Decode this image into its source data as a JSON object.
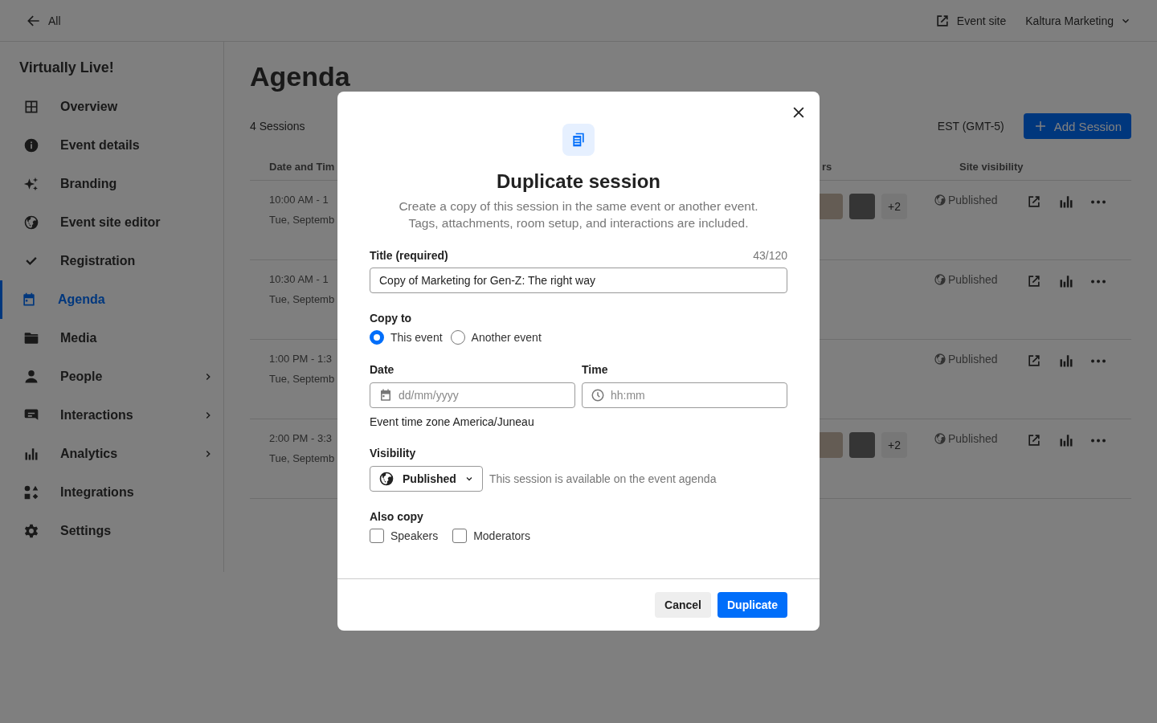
{
  "topbar": {
    "back_label": "All",
    "event_site": "Event site",
    "account": "Kaltura Marketing"
  },
  "sidebar": {
    "title": "Virtually Live!",
    "items": [
      {
        "label": "Overview",
        "selected": false,
        "expandable": false
      },
      {
        "label": "Event details",
        "selected": false,
        "expandable": false
      },
      {
        "label": "Branding",
        "selected": false,
        "expandable": false
      },
      {
        "label": "Event site editor",
        "selected": false,
        "expandable": false
      },
      {
        "label": "Registration",
        "selected": false,
        "expandable": false
      },
      {
        "label": "Agenda",
        "selected": true,
        "expandable": false
      },
      {
        "label": "Media",
        "selected": false,
        "expandable": false
      },
      {
        "label": "People",
        "selected": false,
        "expandable": true
      },
      {
        "label": "Interactions",
        "selected": false,
        "expandable": true
      },
      {
        "label": "Analytics",
        "selected": false,
        "expandable": true
      },
      {
        "label": "Integrations",
        "selected": false,
        "expandable": false
      },
      {
        "label": "Settings",
        "selected": false,
        "expandable": false
      }
    ]
  },
  "page": {
    "title": "Agenda",
    "count": "4 Sessions",
    "timezone": "EST (GMT-5)",
    "add_button": "Add Session",
    "table": {
      "columns": [
        "Date and Tim",
        "rs",
        "Site visibility"
      ],
      "rows": [
        {
          "time": "10:00 AM - 1",
          "date": "Tue, Septemb",
          "speakers_more": "+2",
          "visibility": "Published"
        },
        {
          "time": "10:30 AM - 1",
          "date": "Tue, Septemb",
          "visibility": "Published"
        },
        {
          "time": "1:00 PM - 1:3",
          "date": "Tue, Septemb",
          "visibility": "Published"
        },
        {
          "time": "2:00 PM - 3:3",
          "date": "Tue, Septemb",
          "speakers_more": "+2",
          "visibility": "Published"
        }
      ]
    }
  },
  "dialog": {
    "title": "Duplicate session",
    "description": [
      "Create a copy of this session in the same event or another event.",
      "Tags, attachments, room setup, and interactions are included."
    ],
    "title_field": {
      "label": "Title (required)",
      "counter": "43/120",
      "value": "Copy of Marketing for Gen-Z: The right way"
    },
    "copy_to": {
      "label": "Copy to",
      "options": [
        {
          "label": "This event",
          "selected": true
        },
        {
          "label": "Another event",
          "selected": false
        }
      ]
    },
    "date": {
      "label": "Date",
      "placeholder": "dd/mm/yyyy"
    },
    "time": {
      "label": "Time",
      "placeholder": "hh:mm"
    },
    "timezone_note": "Event time zone America/Juneau",
    "visibility": {
      "label": "Visibility",
      "value": "Published",
      "note": "This session is available on the event agenda"
    },
    "also_copy": {
      "label": "Also copy",
      "options": [
        {
          "label": "Speakers",
          "checked": false
        },
        {
          "label": "Moderators",
          "checked": false
        }
      ]
    },
    "buttons": [
      {
        "label": "Cancel",
        "kind": "secondary"
      },
      {
        "label": "Duplicate",
        "kind": "primary"
      }
    ]
  }
}
